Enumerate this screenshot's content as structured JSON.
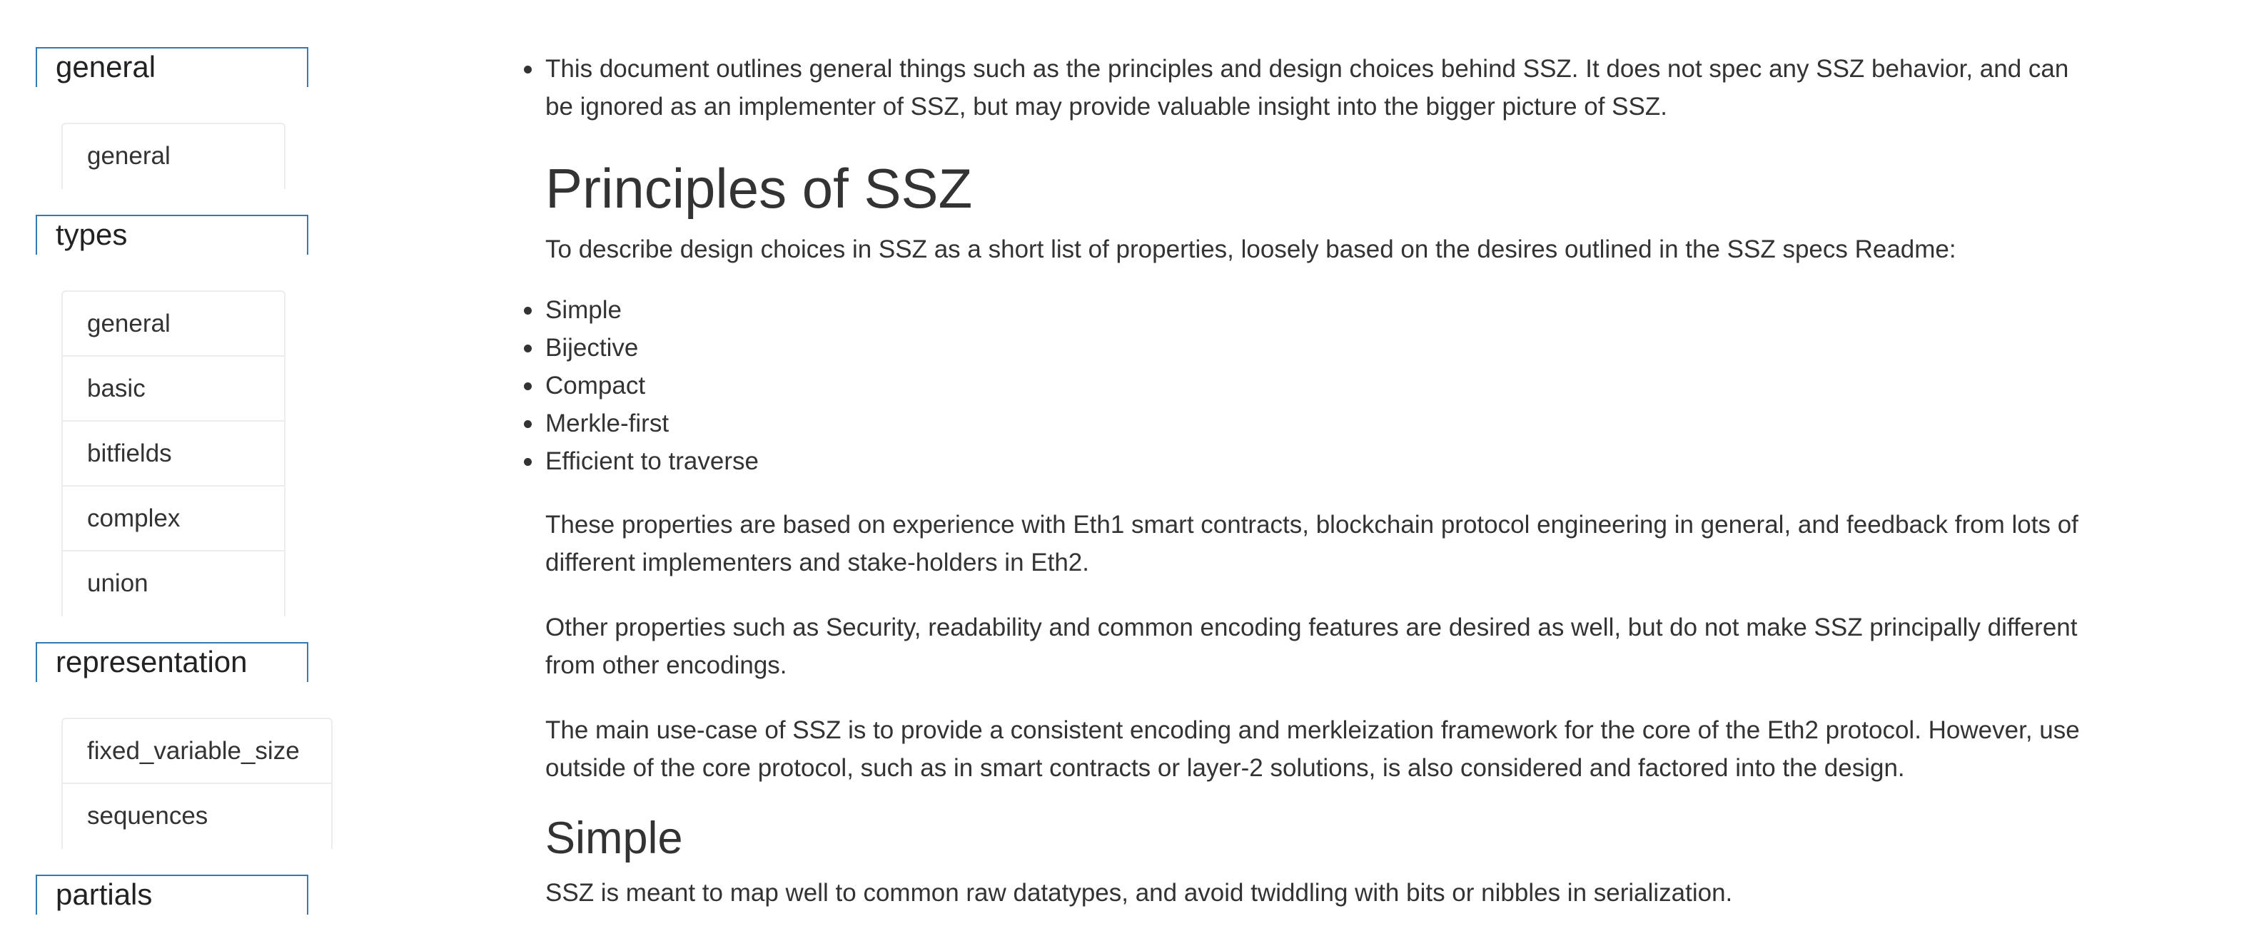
{
  "sidebar": {
    "groups": [
      {
        "title": "general",
        "items": [
          "general"
        ]
      },
      {
        "title": "types",
        "items": [
          "general",
          "basic",
          "bitfields",
          "complex",
          "union"
        ]
      },
      {
        "title": "representation",
        "items": [
          "fixed_variable_size",
          "sequences"
        ]
      },
      {
        "title": "partials",
        "items": []
      }
    ]
  },
  "content": {
    "intro": "This document outlines general things such as the principles and design choices behind SSZ. It does not spec any SSZ behavior, and can be ignored as an implementer of SSZ, but may provide valuable insight into the bigger picture of SSZ.",
    "h1": "Principles of SSZ",
    "describe": "To describe design choices in SSZ as a short list of properties, loosely based on the desires outlined in the SSZ specs Readme:",
    "properties": [
      "Simple",
      "Bijective",
      "Compact",
      "Merkle-first",
      "Efficient to traverse"
    ],
    "p_experience": "These properties are based on experience with Eth1 smart contracts, blockchain protocol engineering in general, and feedback from lots of different implementers and stake-holders in Eth2.",
    "p_other": "Other properties such as Security, readability and common encoding features are desired as well, but do not make SSZ principally different from other encodings.",
    "p_usecase": "The main use-case of SSZ is to provide a consistent encoding and merkleization framework for the core of the Eth2 protocol. However, use outside of the core protocol, such as in smart contracts or layer-2 solutions, is also considered and factored into the design.",
    "h2_simple": "Simple",
    "p_simple": "SSZ is meant to map well to common raw datatypes, and avoid twiddling with bits or nibbles in serialization."
  }
}
